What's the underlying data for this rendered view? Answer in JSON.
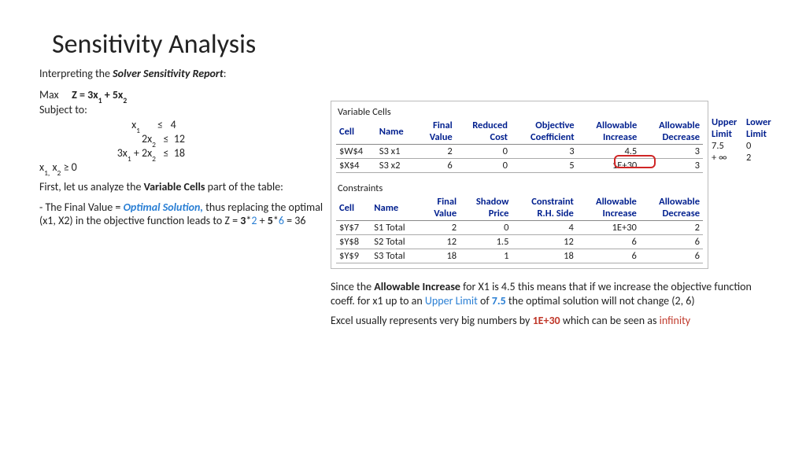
{
  "title": "Sensitivity Analysis",
  "intro_pre": "Interpreting the ",
  "intro_bold": "Solver Sensitivity Report",
  "intro_post": ":",
  "obj": {
    "max": "Max",
    "expr_pre": "Z = 3x",
    "expr_mid": " + 5x",
    "sub1": "1",
    "sub2": "2"
  },
  "subject": "Subject to:",
  "constraints": {
    "c1_lhs": "x",
    "c1_sub": "1",
    "c1_rel": "≤",
    "c1_rhs": "4",
    "c2_lhs": "2x",
    "c2_sub": "2",
    "c2_rel": "≤",
    "c2_rhs": "12",
    "c3_lhs": "3x",
    "c3_sub1": "1",
    "c3_mid": " + 2x",
    "c3_sub2": "2",
    "c3_rel": "≤",
    "c3_rhs": "18",
    "nonneg_pre": "x",
    "nonneg_sub1": "1,",
    "nonneg_mid": " x",
    "nonneg_sub2": "2",
    "nonneg_rel": " ≥ 0"
  },
  "para1_pre": "First, let us analyze the ",
  "para1_bold": "Variable Cells",
  "para1_post": " part of the table:",
  "para2_pre": " - The Final Value = ",
  "para2_blue": "Optimal Solution,",
  "para2_post": " thus replacing the optimal (x1, X2) in the objective function leads to Z = ",
  "para2_b1": "3",
  "para2_s1": "*",
  "para2_c1": "2",
  "para2_plus": " + ",
  "para2_b2": "5",
  "para2_s2": "*",
  "para2_c2": "6",
  "para2_eq": " = 36",
  "vcells_title": "Variable Cells",
  "constraints_title": "Constraints",
  "headers": {
    "cell": "Cell",
    "name": "Name",
    "fv": "Final Value",
    "rc": "Reduced Cost",
    "oc": "Objective Coefficient",
    "ai": "Allowable Increase",
    "ad": "Allowable Decrease",
    "sp": "Shadow Price",
    "rhs": "Constraint R.H. Side",
    "ul": "Upper Limit",
    "ll": "Lower Limit"
  },
  "vcells": [
    {
      "cell": "$W$4",
      "name": "S3 x1",
      "fv": "2",
      "rc": "0",
      "oc": "3",
      "ai": "4.5",
      "ad": "3"
    },
    {
      "cell": "$X$4",
      "name": "S3 x2",
      "fv": "6",
      "rc": "0",
      "oc": "5",
      "ai": "1E+30",
      "ad": "3"
    }
  ],
  "limits_rows": [
    {
      "ul": "7.5",
      "ll": "0"
    },
    {
      "ul": "+ ∞",
      "ll": "2"
    }
  ],
  "crows": [
    {
      "cell": "$Y$7",
      "name": "S1 Total",
      "fv": "2",
      "sp": "0",
      "rhs": "4",
      "ai": "1E+30",
      "ad": "2"
    },
    {
      "cell": "$Y$8",
      "name": "S2 Total",
      "fv": "12",
      "sp": "1.5",
      "rhs": "12",
      "ai": "6",
      "ad": "6"
    },
    {
      "cell": "$Y$9",
      "name": "S3 Total",
      "fv": "18",
      "sp": "1",
      "rhs": "18",
      "ai": "6",
      "ad": "6"
    }
  ],
  "note1_pre": "Since the ",
  "note1_b": "Allowable Increase",
  "note1_mid": " for X1 is 4.5 this means that if we increase the objective function coeff. for x1 up to an ",
  "note1_ul": "Upper Limit",
  "note1_mid2": " of ",
  "note1_val": "7.5",
  "note1_post": " the optimal solution will not change  (2, 6)",
  "note2_pre": "Excel usually represents very big numbers by ",
  "note2_b": "1E+30",
  "note2_mid": " which can be seen as ",
  "note2_inf": "infinity"
}
